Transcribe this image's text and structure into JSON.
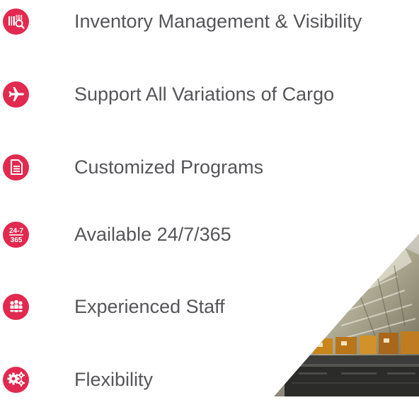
{
  "features": [
    {
      "label": "Inventory Management & Visibility",
      "icon": "barcode-search-icon"
    },
    {
      "label": "Support All Variations of Cargo",
      "icon": "airplane-icon"
    },
    {
      "label": "Customized Programs",
      "icon": "document-icon"
    },
    {
      "label": "Available 24/7/365",
      "icon": "calendar-24-7-365-icon"
    },
    {
      "label": "Experienced Staff",
      "icon": "staff-group-icon"
    },
    {
      "label": "Flexibility",
      "icon": "gears-icon"
    }
  ],
  "icon_text": {
    "top": "24-7",
    "bottom": "365"
  },
  "colors": {
    "accent": "#e2294f",
    "text": "#555559"
  }
}
